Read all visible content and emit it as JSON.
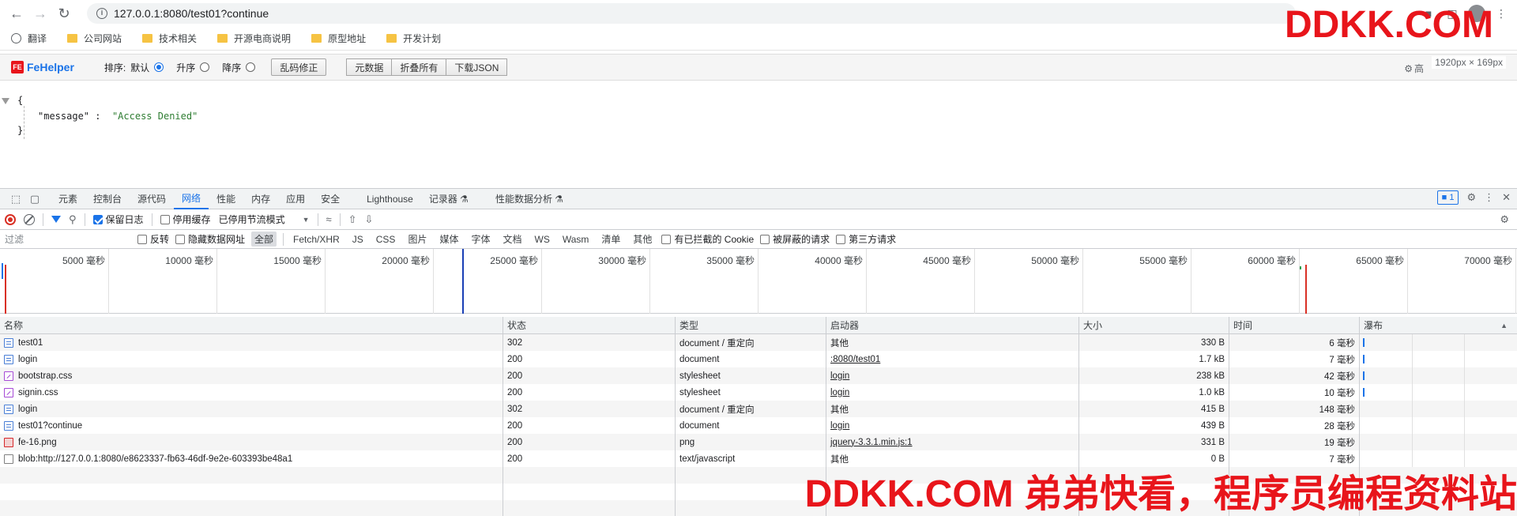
{
  "browser": {
    "url": "127.0.0.1:8080/test01?continue",
    "bookmarks": [
      {
        "label": "翻译",
        "icon": "globe-icon"
      },
      {
        "label": "公司网站",
        "icon": "folder-icon"
      },
      {
        "label": "技术相关",
        "icon": "folder-icon"
      },
      {
        "label": "开源电商说明",
        "icon": "folder-icon"
      },
      {
        "label": "原型地址",
        "icon": "folder-icon"
      },
      {
        "label": "开发计划",
        "icon": "folder-icon"
      }
    ]
  },
  "watermark": {
    "top": "DDKK.COM",
    "bottom": "DDKK.COM 弟弟快看，程序员编程资料站"
  },
  "dimension_badge": "1920px × 169px",
  "fehelper": {
    "logo": "FeHelper",
    "logo_mark": "FE",
    "sort_label": "排序:",
    "sort_default": "默认",
    "sort_asc": "升序",
    "sort_desc": "降序",
    "fix_encoding": "乱码修正",
    "raw_data": "元数据",
    "collapse_all": "折叠所有",
    "download_json": "下载JSON",
    "advanced": "高"
  },
  "json_view": {
    "open": "{",
    "key": "\"message\"",
    "colon": ":",
    "value": "\"Access Denied\"",
    "close": "}"
  },
  "devtools": {
    "tabs": [
      "元素",
      "控制台",
      "源代码",
      "网络",
      "性能",
      "内存",
      "应用",
      "安全",
      "Lighthouse",
      "记录器 ⚗",
      "性能数据分析 ⚗"
    ],
    "active_tab": "网络",
    "message_count": "1",
    "toolbar": {
      "preserve_log": "保留日志",
      "disable_cache": "停用缓存",
      "throttling": "已停用节流模式"
    },
    "filter": {
      "placeholder": "过滤",
      "invert": "反转",
      "hide_data_urls": "隐藏数据网址",
      "types": [
        "全部",
        "Fetch/XHR",
        "JS",
        "CSS",
        "图片",
        "媒体",
        "字体",
        "文档",
        "WS",
        "Wasm",
        "清单",
        "其他"
      ],
      "active_type": "全部",
      "blocked_cookies": "有已拦截的 Cookie",
      "blocked_requests": "被屏蔽的请求",
      "third_party": "第三方请求"
    },
    "overview_ticks": [
      "5000 毫秒",
      "10000 毫秒",
      "15000 毫秒",
      "20000 毫秒",
      "25000 毫秒",
      "30000 毫秒",
      "35000 毫秒",
      "40000 毫秒",
      "45000 毫秒",
      "50000 毫秒",
      "55000 毫秒",
      "60000 毫秒",
      "65000 毫秒",
      "70000 毫秒"
    ],
    "columns": {
      "name": "名称",
      "status": "状态",
      "type": "类型",
      "initiator": "启动器",
      "size": "大小",
      "time": "时间",
      "waterfall": "瀑布"
    },
    "requests": [
      {
        "name": "test01",
        "icon": "document-icon",
        "status": "302",
        "type": "document / 重定向",
        "initiator": "其他",
        "initiator_link": false,
        "size": "330 B",
        "time": "6 毫秒",
        "waterfall": true
      },
      {
        "name": "login",
        "icon": "document-icon",
        "status": "200",
        "type": "document",
        "initiator": ":8080/test01",
        "initiator_link": true,
        "size": "1.7 kB",
        "time": "7 毫秒",
        "waterfall": true
      },
      {
        "name": "bootstrap.css",
        "icon": "stylesheet-icon",
        "status": "200",
        "type": "stylesheet",
        "initiator": "login",
        "initiator_link": true,
        "size": "238 kB",
        "time": "42 毫秒",
        "waterfall": true
      },
      {
        "name": "signin.css",
        "icon": "stylesheet-icon",
        "status": "200",
        "type": "stylesheet",
        "initiator": "login",
        "initiator_link": true,
        "size": "1.0 kB",
        "time": "10 毫秒",
        "waterfall": true
      },
      {
        "name": "login",
        "icon": "document-icon",
        "status": "302",
        "type": "document / 重定向",
        "initiator": "其他",
        "initiator_link": false,
        "size": "415 B",
        "time": "148 毫秒",
        "waterfall": false
      },
      {
        "name": "test01?continue",
        "icon": "document-icon",
        "status": "200",
        "type": "document",
        "initiator": "login",
        "initiator_link": true,
        "size": "439 B",
        "time": "28 毫秒",
        "waterfall": false
      },
      {
        "name": "fe-16.png",
        "icon": "image-icon",
        "status": "200",
        "type": "png",
        "initiator": "jquery-3.3.1.min.js:1",
        "initiator_link": true,
        "size": "331 B",
        "time": "19 毫秒",
        "waterfall": false
      },
      {
        "name": "blob:http://127.0.0.1:8080/e8623337-fb63-46df-9e2e-603393be48a1",
        "icon": "blob-icon",
        "status": "200",
        "type": "text/javascript",
        "initiator": "其他",
        "initiator_link": false,
        "size": "0 B",
        "time": "7 毫秒",
        "waterfall": false
      }
    ]
  }
}
